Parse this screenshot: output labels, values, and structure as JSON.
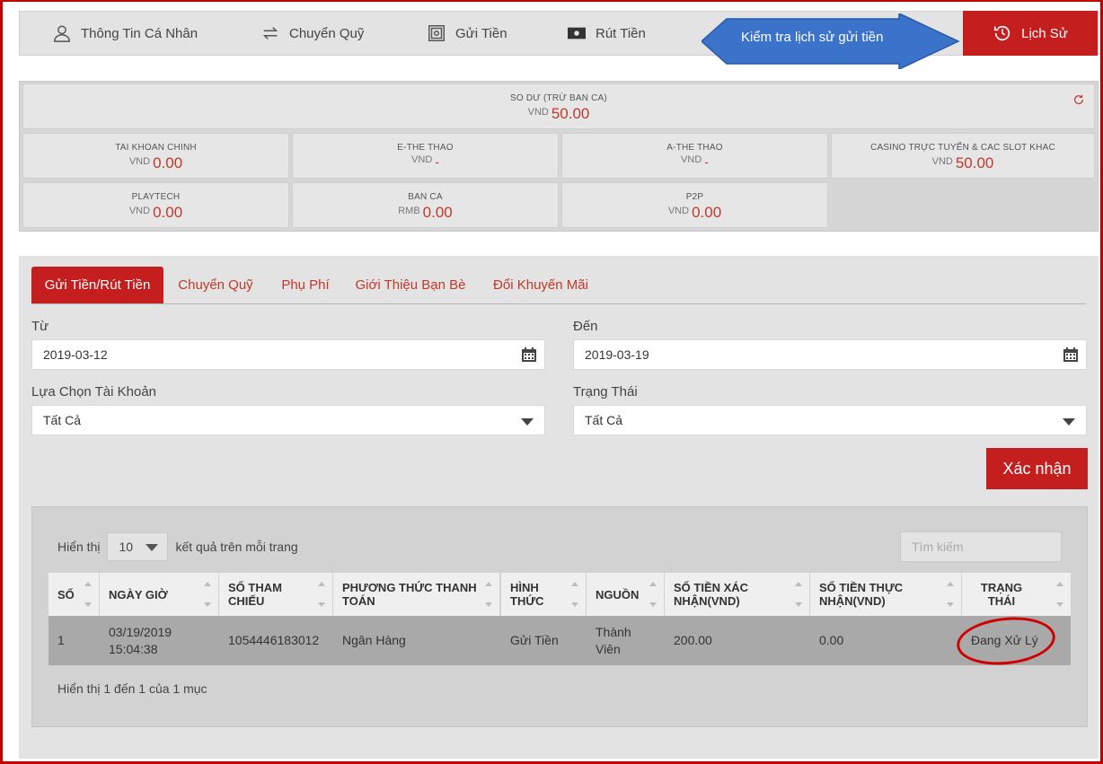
{
  "nav": {
    "items": [
      {
        "label": "Thông Tin Cá Nhân",
        "icon": "user-icon"
      },
      {
        "label": "Chuyển Quỹ",
        "icon": "transfer-icon"
      },
      {
        "label": "Gửi Tiền",
        "icon": "safe-icon"
      },
      {
        "label": "Rút Tiền",
        "icon": "cash-icon"
      }
    ],
    "active": {
      "label": "Lịch Sử",
      "icon": "history-icon"
    }
  },
  "callout": {
    "text": "Kiểm tra lịch sử gửi tiền"
  },
  "balance": {
    "total": {
      "title": "SO DƯ (TRỪ BAN CA)",
      "currency": "VND",
      "value": "50.00"
    },
    "cells": [
      {
        "title": "TAI KHOAN CHINH",
        "currency": "VND",
        "value": "0.00"
      },
      {
        "title": "E-THE THAO",
        "currency": "VND",
        "value": "-"
      },
      {
        "title": "A-THE THAO",
        "currency": "VND",
        "value": "-"
      },
      {
        "title": "CASINO TRỰC TUYẾN & CAC SLOT KHAC",
        "currency": "VND",
        "value": "50.00"
      },
      {
        "title": "PLAYTECH",
        "currency": "VND",
        "value": "0.00"
      },
      {
        "title": "BAN CA",
        "currency": "RMB",
        "value": "0.00"
      },
      {
        "title": "P2P",
        "currency": "VND",
        "value": "0.00"
      }
    ]
  },
  "tabs": [
    "Gửi Tiền/Rút Tiền",
    "Chuyển Quỹ",
    "Phụ Phí",
    "Giới Thiệu Bạn Bè",
    "Đổi Khuyến Mãi"
  ],
  "filters": {
    "from_label": "Từ",
    "from_value": "2019-03-12",
    "to_label": "Đến",
    "to_value": "2019-03-19",
    "account_label": "Lựa Chọn Tài Khoản",
    "account_value": "Tất Cả",
    "status_label": "Trạng Thái",
    "status_value": "Tất Cả",
    "confirm": "Xác nhận"
  },
  "table": {
    "show_prefix": "Hiển thị",
    "page_size": "10",
    "show_suffix": "kết quả trên mỗi trang",
    "search_placeholder": "Tìm kiếm",
    "columns": [
      "SỐ",
      "NGÀY GIỜ",
      "SỐ THAM CHIẾU",
      "PHƯƠNG THỨC THANH TOÁN",
      "HÌNH THỨC",
      "NGUỒN",
      "SỐ TIỀN XÁC NHẬN(VND)",
      "SỐ TIỀN THỰC NHẬN(VND)",
      "TRẠNG THÁI"
    ],
    "rows": [
      [
        "1",
        "03/19/2019 15:04:38",
        "1054446183012",
        "Ngân Hàng",
        "Gửi Tiền",
        "Thành Viên",
        "200.00",
        "0.00",
        "Đang Xử Lý"
      ]
    ],
    "info": "Hiển thị 1 đến 1 của 1 mục"
  },
  "colors": {
    "accent": "#c41e1e",
    "amount": "#c0392b",
    "callout": "#3a73c9",
    "highlight": "#d10000"
  }
}
